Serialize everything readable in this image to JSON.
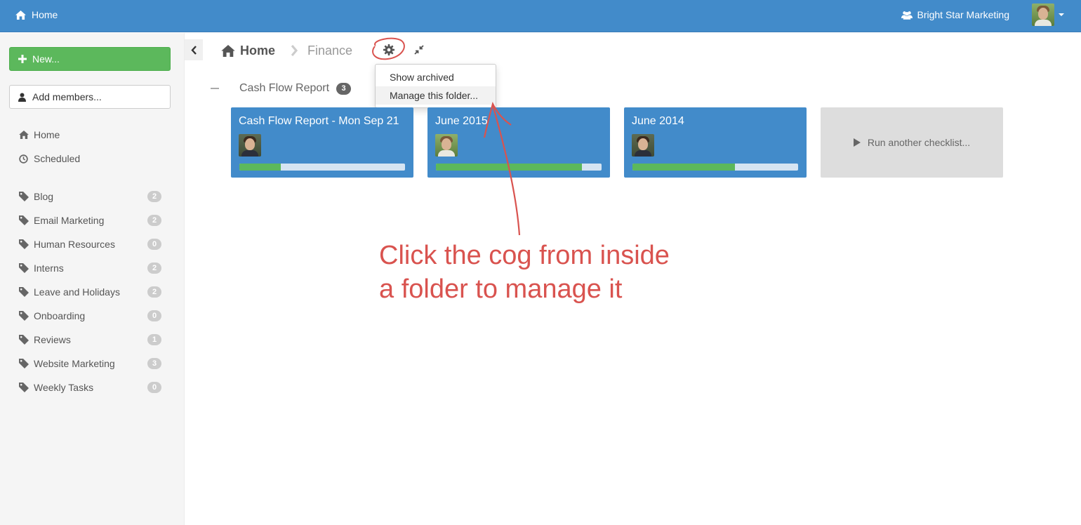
{
  "topbar": {
    "home_label": "Home",
    "org_name": "Bright Star Marketing",
    "icons": {
      "home": "home-icon",
      "org": "users-icon",
      "menu": "caret-down-icon"
    }
  },
  "sidebar": {
    "new_button": "New...",
    "add_members_button": "Add members...",
    "primary": [
      {
        "label": "Home",
        "icon": "home-icon"
      },
      {
        "label": "Scheduled",
        "icon": "clock-icon"
      }
    ],
    "tags": [
      {
        "label": "Blog",
        "count": "2"
      },
      {
        "label": "Email Marketing",
        "count": "2"
      },
      {
        "label": "Human Resources",
        "count": "0"
      },
      {
        "label": "Interns",
        "count": "2"
      },
      {
        "label": "Leave and Holidays",
        "count": "2"
      },
      {
        "label": "Onboarding",
        "count": "0"
      },
      {
        "label": "Reviews",
        "count": "1"
      },
      {
        "label": "Website Marketing",
        "count": "3"
      },
      {
        "label": "Weekly Tasks",
        "count": "0"
      }
    ]
  },
  "breadcrumb": {
    "home": "Home",
    "folder": "Finance"
  },
  "folder_menu": {
    "items": [
      "Show archived",
      "Manage this folder..."
    ],
    "highlighted_index": 1
  },
  "group": {
    "name": "Cash Flow Report",
    "count": "3",
    "cards": [
      {
        "title": "Cash Flow Report - Mon Sep 21",
        "progress": 0.25,
        "avatar": "dark"
      },
      {
        "title": "June 2015",
        "progress": 0.88,
        "avatar": "green"
      },
      {
        "title": "June 2014",
        "progress": 0.62,
        "avatar": "dark"
      }
    ],
    "run_another": "Run another checklist..."
  },
  "annotation": {
    "line1": "Click the cog from inside",
    "line2": "a folder to manage it",
    "color": "#d9534f"
  },
  "colors": {
    "primary": "#428bca",
    "success": "#5cb85c",
    "sidebar_bg": "#f5f5f5"
  }
}
